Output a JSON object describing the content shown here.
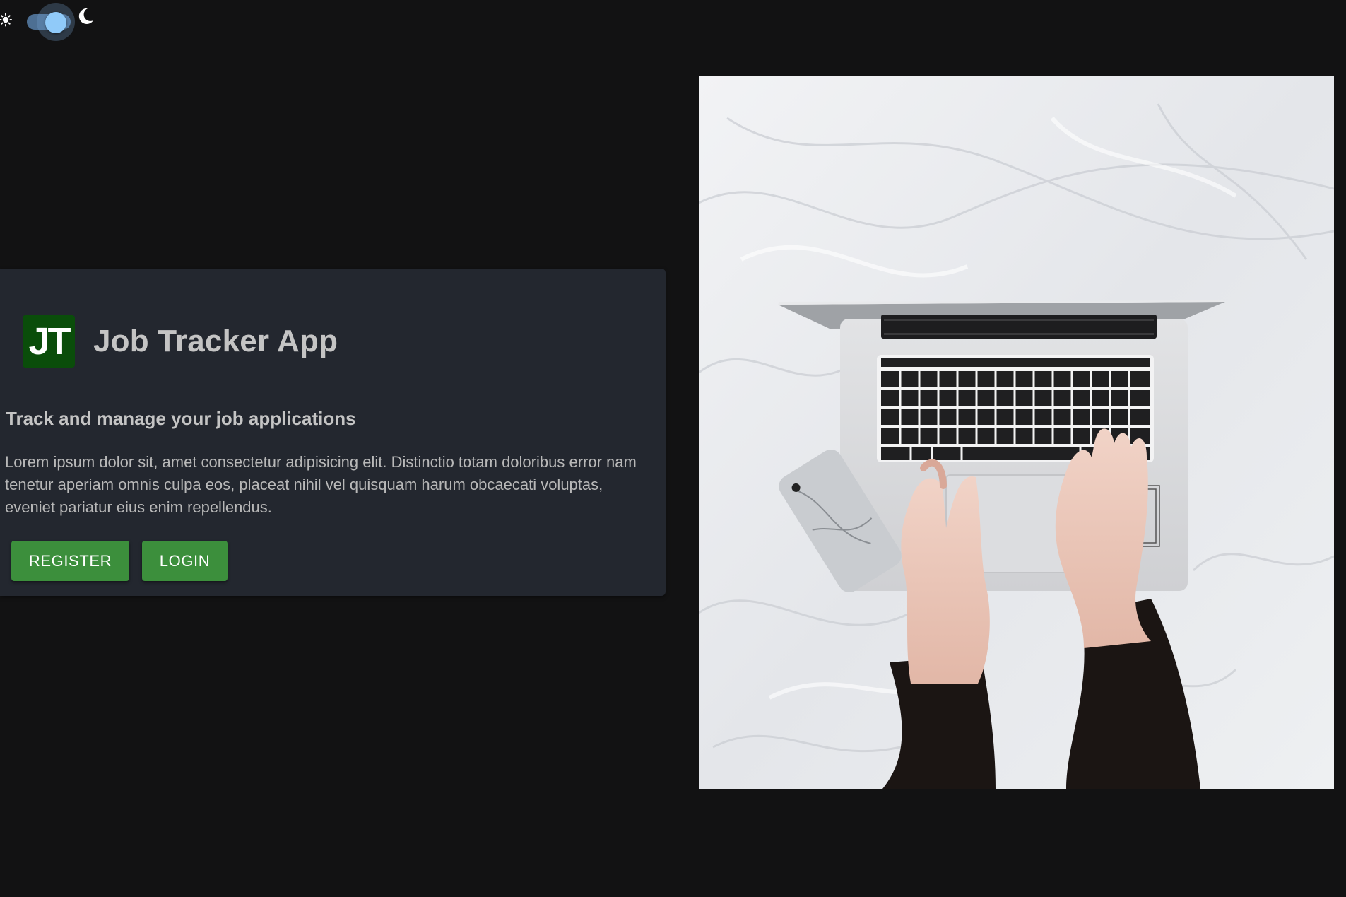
{
  "theme_toggle": {
    "sun_icon": "sun-icon",
    "moon_icon": "moon-icon",
    "state": "dark"
  },
  "card": {
    "logo_text": "JT",
    "title": "Job Tracker App",
    "tagline": "Track and manage your job applications",
    "description": "Lorem ipsum dolor sit, amet consectetur adipisicing elit. Distinctio totam doloribus error nam tenetur aperiam omnis culpa eos, placeat nihil vel quisquam harum obcaecati voluptas, eveniet pariatur eius enim repellendus.",
    "register_label": "REGISTER",
    "login_label": "LOGIN"
  },
  "colors": {
    "background": "#121213",
    "card": "#23272f",
    "button": "#3c8f3c",
    "logo": "#0a4d0a",
    "toggle_thumb": "#90caf9"
  }
}
